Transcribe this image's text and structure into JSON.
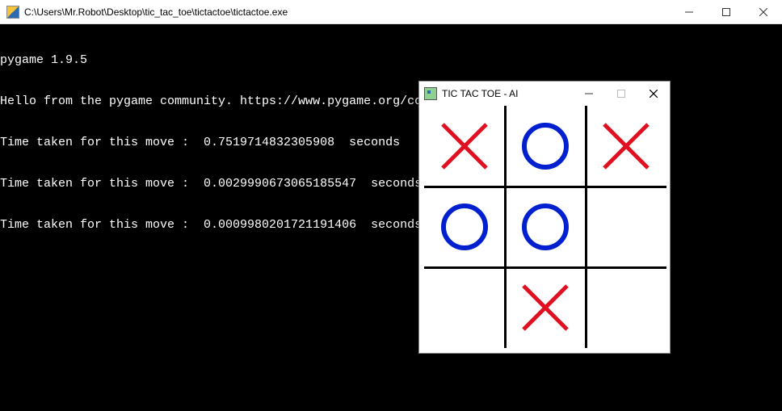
{
  "console": {
    "title": "C:\\Users\\Mr.Robot\\Desktop\\tic_tac_toe\\tictactoe\\tictactoe.exe",
    "lines": [
      "pygame 1.9.5",
      "Hello from the pygame community. https://www.pygame.org/contribute.html",
      "Time taken for this move :  0.7519714832305908  seconds",
      "Time taken for this move :  0.0029990673065185547  seconds",
      "Time taken for this move :  0.0009980201721191406  seconds"
    ]
  },
  "game": {
    "title": "TIC TAC TOE - AI",
    "board": [
      [
        "X",
        "O",
        "X"
      ],
      [
        "O",
        "O",
        ""
      ],
      [
        "",
        "X",
        ""
      ]
    ],
    "colors": {
      "x": "#e01020",
      "o": "#0020d0",
      "grid": "#000000"
    }
  }
}
